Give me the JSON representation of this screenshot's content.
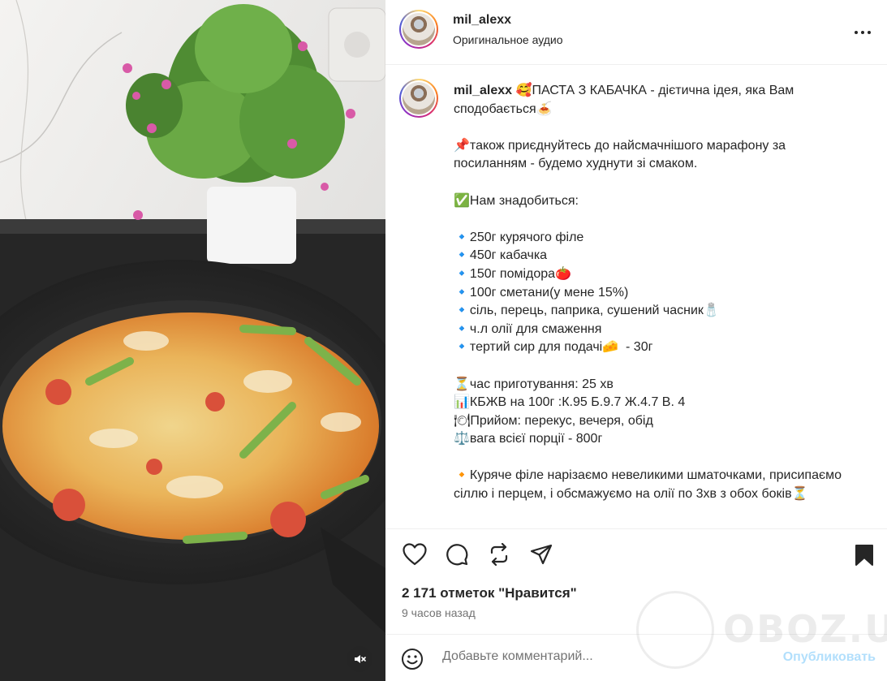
{
  "post": {
    "username": "mil_alexx",
    "audio": "Оригинальное аудио"
  },
  "caption": {
    "username": "mil_alexx",
    "text": "🥰ПАСТА З КАБАЧКА - дієтична ідея, яка Вам сподобається🍝\n\n📌також приєднуйтесь до найсмачнішого марафону за посиланням - будемо худнути зі смаком.\n\n✅Нам знадобиться:\n\n🔹250г курячого філе\n🔹450г кабачка\n🔹150г помідора🍅\n🔹100г сметани(у мене 15%)\n🔹сіль, перець, паприка, сушений часник🧂\n🔹ч.л олії для смаження\n🔹тертий сир для подачі🧀  - 30г\n\n⏳час приготування: 25 хв\n📊КБЖВ на 100г :К.95 Б.9.7 Ж.4.7 В. 4\n🍽Прийом: перекус, вечеря, обід\n⚖️вага всієї порції - 800г\n\n🔸Куряче філе нарізаємо невеликими шматочками, присипаємо сіллю і перцем, і обсмажуємо на олії по 3хв з обох боків⏳"
  },
  "actions": {
    "like_icon": "heart-icon",
    "comment_icon": "comment-icon",
    "share_icon": "repost-icon",
    "send_icon": "send-icon",
    "save_icon": "bookmark-icon"
  },
  "stats": {
    "likes": "2 171 отметок \"Нравится\"",
    "time_ago": "9 часов назад"
  },
  "comment": {
    "placeholder": "Добавьте комментарий...",
    "post_label": "Опубликовать"
  },
  "watermark": {
    "text": "OBOZ.UA"
  },
  "colors": {
    "accent_disabled": "#b2dffc",
    "text": "#262626",
    "secondary": "#737373",
    "divider": "#efefef"
  }
}
